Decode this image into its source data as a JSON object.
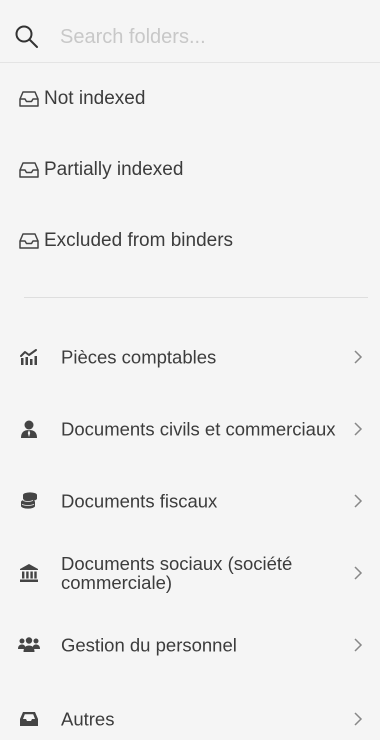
{
  "search": {
    "placeholder": "Search folders..."
  },
  "status_filters": [
    {
      "label": "Not indexed",
      "icon": "inbox-icon"
    },
    {
      "label": "Partially indexed",
      "icon": "inbox-icon"
    },
    {
      "label": "Excluded from binders",
      "icon": "inbox-icon"
    }
  ],
  "folders": [
    {
      "label": "Pièces comptables",
      "icon": "chart-line-icon"
    },
    {
      "label": "Documents civils et commerciaux",
      "icon": "user-tie-icon"
    },
    {
      "label": "Documents fiscaux",
      "icon": "coins-icon"
    },
    {
      "label": "Documents sociaux (société commerciale)",
      "icon": "landmark-icon"
    },
    {
      "label": "Gestion du personnel",
      "icon": "users-icon"
    },
    {
      "label": "Autres",
      "icon": "inbox-solid-icon"
    }
  ],
  "colors": {
    "background": "#f5f5f5",
    "text": "#3c3c3c",
    "placeholder": "#c8c8c8",
    "icon": "#444444"
  }
}
